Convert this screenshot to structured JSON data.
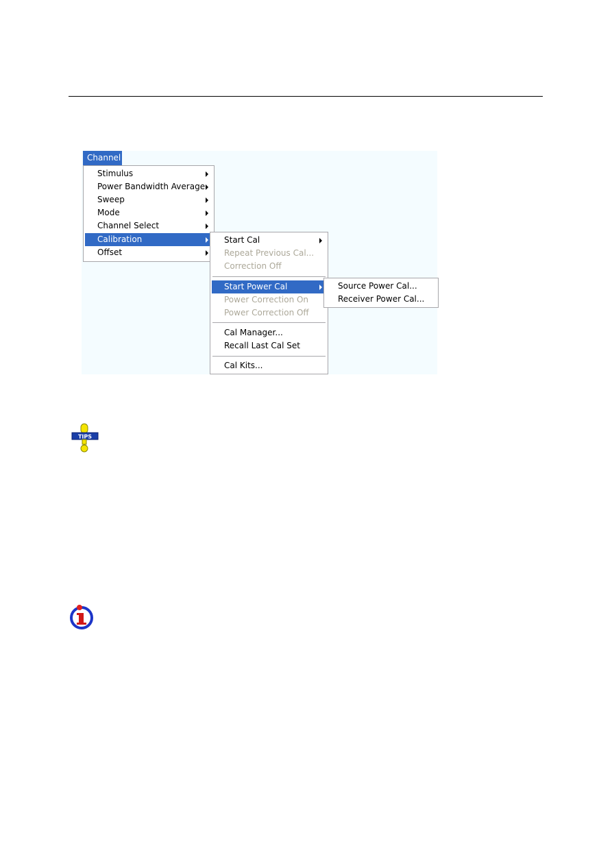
{
  "menubar": {
    "channel_label": "Channel"
  },
  "channel_menu": {
    "items": [
      {
        "label": "Stimulus",
        "submenu": true
      },
      {
        "label": "Power Bandwidth Average",
        "submenu": true
      },
      {
        "label": "Sweep",
        "submenu": true
      },
      {
        "label": "Mode",
        "submenu": true
      },
      {
        "label": "Channel Select",
        "submenu": true
      },
      {
        "label": "Calibration",
        "submenu": true,
        "selected": true
      },
      {
        "label": "Offset",
        "submenu": true
      }
    ]
  },
  "calibration_menu": {
    "items": [
      {
        "label": "Start Cal",
        "submenu": true
      },
      {
        "label": "Repeat Previous Cal...",
        "disabled": true
      },
      {
        "label": "Correction Off",
        "disabled": true
      },
      {
        "label": "Start Power Cal",
        "submenu": true,
        "selected": true
      },
      {
        "label": "Power Correction On",
        "disabled": true
      },
      {
        "label": "Power Correction Off",
        "disabled": true
      },
      {
        "label": "Cal Manager..."
      },
      {
        "label": "Recall Last Cal Set"
      },
      {
        "label": "Cal Kits..."
      }
    ]
  },
  "power_cal_menu": {
    "items": [
      {
        "label": "Source Power Cal..."
      },
      {
        "label": "Receiver Power Cal..."
      }
    ]
  },
  "icons": {
    "tips": {
      "name": "tips-icon",
      "text": "TIPS"
    },
    "info": {
      "name": "info-icon",
      "text": "i"
    }
  },
  "colors": {
    "selection": "#316ac5",
    "disabled_text": "#aca899",
    "screen_background": "#f4fcff"
  }
}
